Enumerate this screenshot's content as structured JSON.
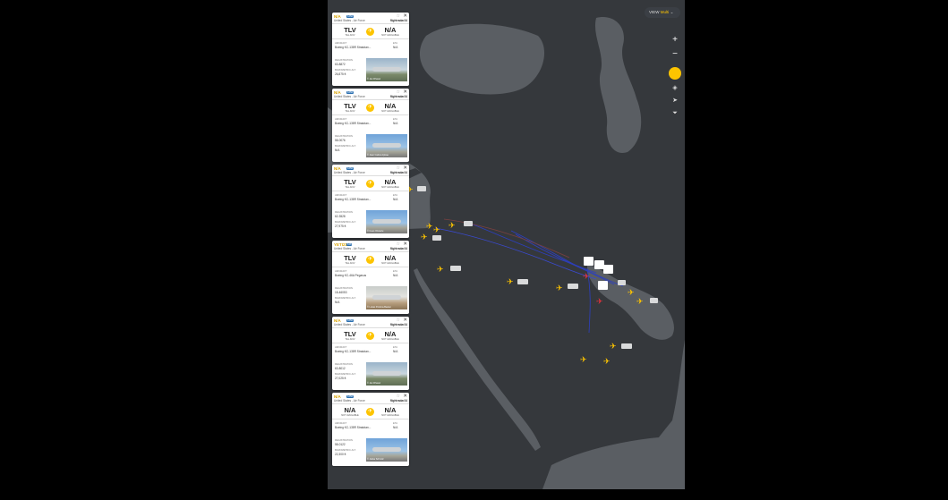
{
  "flights": [
    {
      "callsign": "N/A",
      "tag": "K35R",
      "operator": "United States - Air Force",
      "brand": "flightradar24",
      "from_code": "TLV",
      "from_name": "TEL AVIV",
      "to_code": "N/A",
      "to_name": "NOT AVAILABLE",
      "aircraft_label": "AIRCRAFT",
      "aircraft": "Boeing KC-135R Stratotan...",
      "eta_label": "ETA",
      "eta": "N/A",
      "reg_label": "REGISTRATION",
      "registration": "63-8872",
      "alt_label": "BAROMETRIC ALT.",
      "altitude": "26,875 ft",
      "photo_credit": "© Jan Rhavel"
    },
    {
      "callsign": "N/A",
      "tag": "K35R",
      "operator": "United States - Air Force",
      "brand": "flightradar24",
      "from_code": "TLV",
      "from_name": "TEL AVIV",
      "to_code": "N/A",
      "to_name": "NOT AVAILABLE",
      "aircraft_label": "AIRCRAFT",
      "aircraft": "Boeing KC-135R Stratotan...",
      "eta_label": "ETA",
      "eta": "N/A",
      "reg_label": "REGISTRATION",
      "registration": "58-0076",
      "alt_label": "BAROMETRIC ALT.",
      "altitude": "N/A",
      "photo_credit": "© Juan Carlos Apicae"
    },
    {
      "callsign": "N/A",
      "tag": "K35R",
      "operator": "United States - Air Force",
      "brand": "flightradar24",
      "from_code": "TLV",
      "from_name": "TEL AVIV",
      "to_code": "N/A",
      "to_name": "NOT AVAILABLE",
      "aircraft_label": "AIRCRAFT",
      "aircraft": "Boeing KC-135R Stratotan...",
      "eta_label": "ETA",
      "eta": "N/A",
      "reg_label": "REGISTRATION",
      "registration": "62-3528",
      "alt_label": "BAROMETRIC ALT.",
      "altitude": "27,975 ft",
      "photo_credit": "© Cees Olsnerie"
    },
    {
      "callsign": "YETI21",
      "tag": "K46",
      "operator": "United States - Air Force",
      "brand": "flightradar24",
      "from_code": "TLV",
      "from_name": "TEL AVIV",
      "to_code": "N/A",
      "to_name": "NOT AVAILABLE",
      "aircraft_label": "AIRCRAFT",
      "aircraft": "Boeing KC-46A Pegasus",
      "eta_label": "ETA",
      "eta": "N/A",
      "reg_label": "REGISTRATION",
      "registration": "18-46053",
      "alt_label": "BAROMETRIC ALT.",
      "altitude": "N/A",
      "photo_credit": "© Lukas Postma-Beelen"
    },
    {
      "callsign": "N/A",
      "tag": "K35R",
      "operator": "United States - Air Force",
      "brand": "flightradar24",
      "from_code": "TLV",
      "from_name": "TEL AVIV",
      "to_code": "N/A",
      "to_name": "NOT AVAILABLE",
      "aircraft_label": "AIRCRAFT",
      "aircraft": "Boeing KC-135R Stratotan...",
      "eta_label": "ETA",
      "eta": "N/A",
      "reg_label": "REGISTRATION",
      "registration": "63-8012",
      "alt_label": "BAROMETRIC ALT.",
      "altitude": "27,025 ft",
      "photo_credit": "© Jan Rhavel"
    },
    {
      "callsign": "N/A",
      "tag": "K35R",
      "operator": "United States - Air Force",
      "brand": "flightradar24",
      "from_code": "N/A",
      "from_name": "NOT AVAILABLE",
      "to_code": "N/A",
      "to_name": "NOT AVAILABLE",
      "aircraft_label": "AIRCRAFT",
      "aircraft": "Boeing KC-135R Stratotan...",
      "eta_label": "ETA",
      "eta": "N/A",
      "reg_label": "REGISTRATION",
      "registration": "58-0122",
      "alt_label": "BAROMETRIC ALT.",
      "altitude": "22,300 ft",
      "photo_credit": "© Jukka Schmitz"
    }
  ],
  "view_button": {
    "label": "VIEW",
    "mode": "Multi"
  },
  "controls": {
    "zoom_in": "+",
    "zoom_out": "−"
  },
  "colors": {
    "water": "#5a5e63",
    "land": "#35383c",
    "accent": "#fdc400",
    "track_blue": "#2d3fbe",
    "track_red": "#e0323c"
  }
}
